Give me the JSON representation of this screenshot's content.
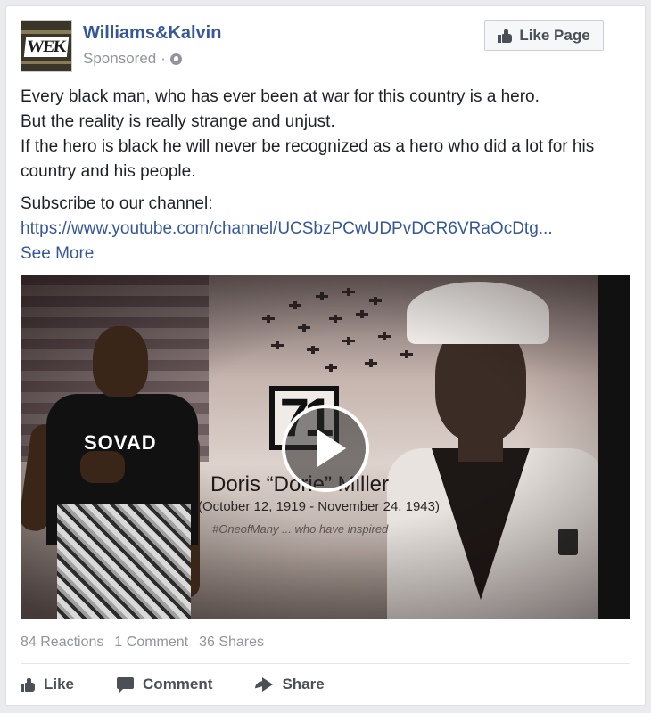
{
  "header": {
    "avatar_logo": "WEK",
    "page_name": "Williams&Kalvin",
    "sponsored": "Sponsored",
    "separator": "·",
    "like_page": "Like Page",
    "globe_icon": "globe-icon",
    "like_icon": "thumbs-up-icon"
  },
  "post": {
    "lines": [
      "Every black man, who has ever been at war for this country is a hero.",
      "But the reality is really strange and unjust.",
      "If the hero is black he will never be recognized as a hero who did a lot for his country and his people."
    ],
    "subscribe": "Subscribe to our channel:",
    "link": "https://www.youtube.com/channel/UCSbzPCwUDPvDCR6VRaOcDtg...",
    "see_more": "See More"
  },
  "video": {
    "shirt_text": "SOVAD",
    "number": "71",
    "title": "Doris “Dorie” Miller",
    "dates": "(October 12, 1919 - November 24, 1943)",
    "hashtag": "#OneofMany ... who have inspired",
    "play_icon": "play-icon"
  },
  "stats": {
    "reactions": "84 Reactions",
    "comments": "1 Comment",
    "shares": "36 Shares"
  },
  "actions": {
    "like": "Like",
    "comment": "Comment",
    "share": "Share"
  },
  "colors": {
    "link": "#365899",
    "text": "#1d2129",
    "muted": "#90949c",
    "action": "#4b4f56"
  }
}
